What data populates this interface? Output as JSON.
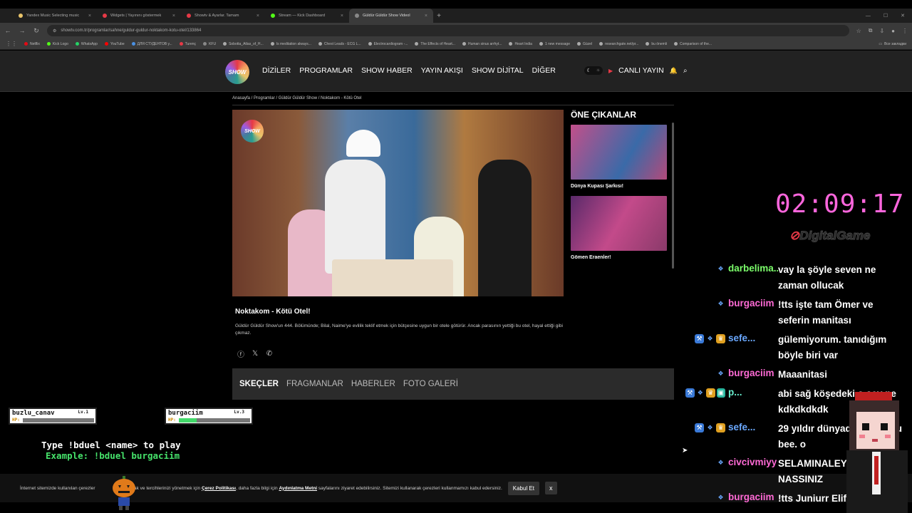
{
  "browser": {
    "tabs": [
      {
        "title": "Yandex Music Selecting music",
        "color": "#e9c46a",
        "active": false
      },
      {
        "title": "Widgets | Yayınını göstermek",
        "color": "#e63946",
        "active": false
      },
      {
        "title": "Showtv & Ayarlar. Tamam",
        "color": "#e63946",
        "active": false
      },
      {
        "title": "Stream — Kick Dashboard",
        "color": "#53fc18",
        "active": false
      },
      {
        "title": "Güldür Güldür Show Videol",
        "color": "#888888",
        "active": true
      }
    ],
    "url": "showtv.com.tr/programlar/sahne/guldur-guldur-noktakom-kotu-otel/133864",
    "bookmarks": [
      {
        "label": "Netflix",
        "color": "#e50914"
      },
      {
        "label": "Kick Logo",
        "color": "#53fc18"
      },
      {
        "label": "WhatsApp",
        "color": "#25d366"
      },
      {
        "label": "YouTube",
        "color": "#ff0000"
      },
      {
        "label": "ДЛЯ СТУДЕНТОВ у...",
        "color": "#4a90e2"
      },
      {
        "label": "Turenç",
        "color": "#e63946"
      },
      {
        "label": "KFU",
        "color": "#888888"
      },
      {
        "label": "Sobotta_Atlas_of_H...",
        "color": "#aaaaaa"
      },
      {
        "label": "Is meditation always...",
        "color": "#aaaaaa"
      },
      {
        "label": "Chest Leads - ECG L...",
        "color": "#aaaaaa"
      },
      {
        "label": "Electrocardiogram -...",
        "color": "#aaaaaa"
      },
      {
        "label": "The Effects of Heart...",
        "color": "#aaaaaa"
      },
      {
        "label": "Human sinus arrhyt...",
        "color": "#aaaaaa"
      },
      {
        "label": "Heart India",
        "color": "#aaaaaa"
      },
      {
        "label": "1 new message",
        "color": "#aaaaaa"
      },
      {
        "label": "Güzel",
        "color": "#aaaaaa"
      },
      {
        "label": "researchgate.net/pr...",
        "color": "#aaaaaa"
      },
      {
        "label": "bu önemli",
        "color": "#aaaaaa"
      },
      {
        "label": "Comparison of the...",
        "color": "#aaaaaa"
      }
    ],
    "bookmarks_right": "Все закладки"
  },
  "site": {
    "logo_text": "SHOW",
    "nav": [
      "DİZİLER",
      "PROGRAMLAR",
      "SHOW HABER",
      "YAYIN AKIŞI",
      "SHOW DİJİTAL",
      "DİĞER"
    ],
    "live_label": "CANLI YAYIN",
    "breadcrumb": "Anasayfa / Programlar / Güldür Güldür Show / Noktakom - Kötü Otel",
    "video_title": "Noktakom - Kötü Otel!",
    "video_desc": "Güldür Güldür Show'un 444. Bölümünde; Bilal, Naime'ye evlilik teklif etmek için bütçesine uygun bir otele götürür. Ancak parasının yettiği bu otel, hayal ettiği gibi çıkmaz.",
    "sidebar_title": "ÖNE ÇIKANLAR",
    "sidebar_items": [
      {
        "caption": "Dünya Kupası Şarkısı!"
      },
      {
        "caption": "Gömen Eraenler!"
      }
    ],
    "tabs": [
      "SKEÇLER",
      "FRAGMANLAR",
      "HABERLER",
      "FOTO GALERİ"
    ],
    "cookie": {
      "text1": "İnternet sitemizde kullanılan çerezler",
      "text2": "almak ve tercihlerinizi yönetmek için",
      "link1": "Çerez Politikası",
      "text3": "daha fazla bilgi için",
      "link2": "Aydınlatma Metni",
      "text4": "sayfalarını ziyaret edebilirsiniz. Sitemizi kullanarak çerezleri kullanmamızı kabul edersiniz.",
      "accept": "Kabul Et",
      "close": "x"
    }
  },
  "overlay": {
    "timer": "02:09:17",
    "sponsor": "DigitalGame",
    "duel_line1": "Type !bduel <name> to play",
    "duel_line2": "Example: !bduel burgaciim",
    "players": [
      {
        "name": "buzlu_canav",
        "level": "Lv.1",
        "hp_label": "HP:",
        "hp_fraction": 0.0
      },
      {
        "name": "burgaciim",
        "level": "Lv.3",
        "hp_label": "HP:",
        "hp_fraction": 0.25
      }
    ]
  },
  "chat": [
    {
      "user": "darbelima...",
      "color": "#7cff6b",
      "badges": [
        "sub"
      ],
      "text": "vay la şöyle seven ne zaman ollucak"
    },
    {
      "user": "burgaciim",
      "color": "#ff6ad5",
      "badges": [
        "sub"
      ],
      "text": "!tts işte tam Ömer ve seferin manitası"
    },
    {
      "user": "sefe...",
      "color": "#6aa8ff",
      "badges": [
        "mod",
        "sub",
        "crown"
      ],
      "text": "gülemiyorum. tanıdığım böyle biri var"
    },
    {
      "user": "burgaciim",
      "color": "#ff6ad5",
      "badges": [
        "sub"
      ],
      "text": "Maaanitasi"
    },
    {
      "user": "p...",
      "color": "#6af0d0",
      "badges": [
        "mod",
        "sub",
        "crown",
        "gift"
      ],
      "text": "abi sağ köşedeki o şey ne kdkdkdkdk"
    },
    {
      "user": "sefe...",
      "color": "#6aa8ff",
      "badges": [
        "mod",
        "sub",
        "crown"
      ],
      "text": "29 yıldır dünyada tane oldu bee. o"
    },
    {
      "user": "civcivmiyy",
      "color": "#ff6ad5",
      "badges": [
        "sub"
      ],
      "text": "SELAMINALEYKÜM HANIM NASSINIZ"
    },
    {
      "user": "burgaciim",
      "color": "#ff6ad5",
      "badges": [
        "sub"
      ],
      "text": "!tts Juniurr Elif o"
    }
  ]
}
